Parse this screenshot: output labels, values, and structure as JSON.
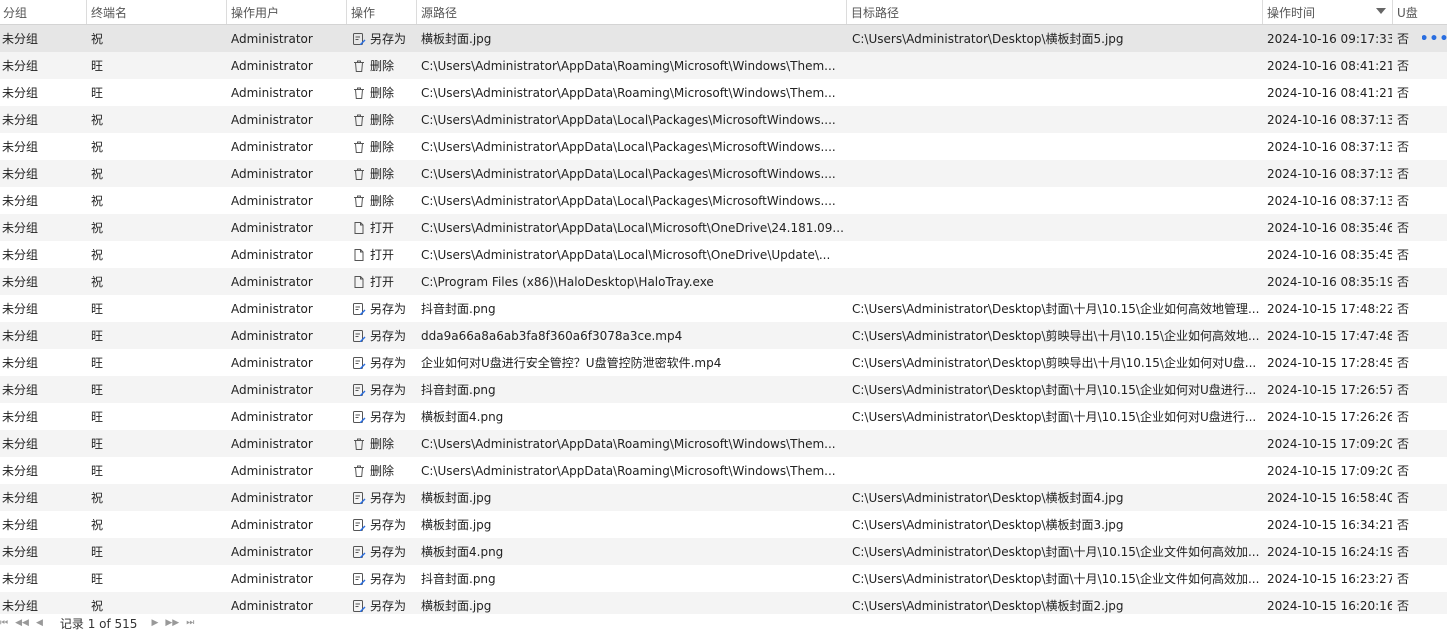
{
  "columns": {
    "group": "分组",
    "terminal": "终端名",
    "user": "操作用户",
    "operation": "操作",
    "source": "源路径",
    "target": "目标路径",
    "time": "操作时间",
    "usb": "U盘"
  },
  "rows": [
    {
      "group": "未分组",
      "terminal": "祝",
      "user": "Administrator",
      "op": "另存为",
      "op_icon": "save-as-icon",
      "source": "横板封面.jpg",
      "target": "C:\\Users\\Administrator\\Desktop\\横板封面5.jpg",
      "time": "2024-10-16 09:17:33",
      "usb": "否"
    },
    {
      "group": "未分组",
      "terminal": "旺",
      "user": "Administrator",
      "op": "删除",
      "op_icon": "trash-icon",
      "source": "C:\\Users\\Administrator\\AppData\\Roaming\\Microsoft\\Windows\\Them...",
      "target": "",
      "time": "2024-10-16 08:41:21",
      "usb": "否"
    },
    {
      "group": "未分组",
      "terminal": "旺",
      "user": "Administrator",
      "op": "删除",
      "op_icon": "trash-icon",
      "source": "C:\\Users\\Administrator\\AppData\\Roaming\\Microsoft\\Windows\\Them...",
      "target": "",
      "time": "2024-10-16 08:41:21",
      "usb": "否"
    },
    {
      "group": "未分组",
      "terminal": "祝",
      "user": "Administrator",
      "op": "删除",
      "op_icon": "trash-icon",
      "source": "C:\\Users\\Administrator\\AppData\\Local\\Packages\\MicrosoftWindows....",
      "target": "",
      "time": "2024-10-16 08:37:13",
      "usb": "否"
    },
    {
      "group": "未分组",
      "terminal": "祝",
      "user": "Administrator",
      "op": "删除",
      "op_icon": "trash-icon",
      "source": "C:\\Users\\Administrator\\AppData\\Local\\Packages\\MicrosoftWindows....",
      "target": "",
      "time": "2024-10-16 08:37:13",
      "usb": "否"
    },
    {
      "group": "未分组",
      "terminal": "祝",
      "user": "Administrator",
      "op": "删除",
      "op_icon": "trash-icon",
      "source": "C:\\Users\\Administrator\\AppData\\Local\\Packages\\MicrosoftWindows....",
      "target": "",
      "time": "2024-10-16 08:37:13",
      "usb": "否"
    },
    {
      "group": "未分组",
      "terminal": "祝",
      "user": "Administrator",
      "op": "删除",
      "op_icon": "trash-icon",
      "source": "C:\\Users\\Administrator\\AppData\\Local\\Packages\\MicrosoftWindows....",
      "target": "",
      "time": "2024-10-16 08:37:13",
      "usb": "否"
    },
    {
      "group": "未分组",
      "terminal": "祝",
      "user": "Administrator",
      "op": "打开",
      "op_icon": "file-icon",
      "source": "C:\\Users\\Administrator\\AppData\\Local\\Microsoft\\OneDrive\\24.181.09...",
      "target": "",
      "time": "2024-10-16 08:35:46",
      "usb": "否"
    },
    {
      "group": "未分组",
      "terminal": "祝",
      "user": "Administrator",
      "op": "打开",
      "op_icon": "file-icon",
      "source": "C:\\Users\\Administrator\\AppData\\Local\\Microsoft\\OneDrive\\Update\\...",
      "target": "",
      "time": "2024-10-16 08:35:45",
      "usb": "否"
    },
    {
      "group": "未分组",
      "terminal": "祝",
      "user": "Administrator",
      "op": "打开",
      "op_icon": "file-icon",
      "source": "C:\\Program Files (x86)\\HaloDesktop\\HaloTray.exe",
      "target": "",
      "time": "2024-10-16 08:35:19",
      "usb": "否"
    },
    {
      "group": "未分组",
      "terminal": "旺",
      "user": "Administrator",
      "op": "另存为",
      "op_icon": "save-as-icon",
      "source": "抖音封面.png",
      "target": "C:\\Users\\Administrator\\Desktop\\封面\\十月\\10.15\\企业如何高效地管理...",
      "time": "2024-10-15 17:48:22",
      "usb": "否"
    },
    {
      "group": "未分组",
      "terminal": "旺",
      "user": "Administrator",
      "op": "另存为",
      "op_icon": "save-as-icon",
      "source": "dda9a66a8a6ab3fa8f360a6f3078a3ce.mp4",
      "target": "C:\\Users\\Administrator\\Desktop\\剪映导出\\十月\\10.15\\企业如何高效地...",
      "time": "2024-10-15 17:47:48",
      "usb": "否"
    },
    {
      "group": "未分组",
      "terminal": "旺",
      "user": "Administrator",
      "op": "另存为",
      "op_icon": "save-as-icon",
      "source": "企业如何对U盘进行安全管控？U盘管控防泄密软件.mp4",
      "target": "C:\\Users\\Administrator\\Desktop\\剪映导出\\十月\\10.15\\企业如何对U盘...",
      "time": "2024-10-15 17:28:45",
      "usb": "否"
    },
    {
      "group": "未分组",
      "terminal": "旺",
      "user": "Administrator",
      "op": "另存为",
      "op_icon": "save-as-icon",
      "source": "抖音封面.png",
      "target": "C:\\Users\\Administrator\\Desktop\\封面\\十月\\10.15\\企业如何对U盘进行...",
      "time": "2024-10-15 17:26:57",
      "usb": "否"
    },
    {
      "group": "未分组",
      "terminal": "旺",
      "user": "Administrator",
      "op": "另存为",
      "op_icon": "save-as-icon",
      "source": "横板封面4.png",
      "target": "C:\\Users\\Administrator\\Desktop\\封面\\十月\\10.15\\企业如何对U盘进行...",
      "time": "2024-10-15 17:26:26",
      "usb": "否"
    },
    {
      "group": "未分组",
      "terminal": "旺",
      "user": "Administrator",
      "op": "删除",
      "op_icon": "trash-icon",
      "source": "C:\\Users\\Administrator\\AppData\\Roaming\\Microsoft\\Windows\\Them...",
      "target": "",
      "time": "2024-10-15 17:09:20",
      "usb": "否"
    },
    {
      "group": "未分组",
      "terminal": "旺",
      "user": "Administrator",
      "op": "删除",
      "op_icon": "trash-icon",
      "source": "C:\\Users\\Administrator\\AppData\\Roaming\\Microsoft\\Windows\\Them...",
      "target": "",
      "time": "2024-10-15 17:09:20",
      "usb": "否"
    },
    {
      "group": "未分组",
      "terminal": "祝",
      "user": "Administrator",
      "op": "另存为",
      "op_icon": "save-as-icon",
      "source": "横板封面.jpg",
      "target": "C:\\Users\\Administrator\\Desktop\\横板封面4.jpg",
      "time": "2024-10-15 16:58:40",
      "usb": "否"
    },
    {
      "group": "未分组",
      "terminal": "祝",
      "user": "Administrator",
      "op": "另存为",
      "op_icon": "save-as-icon",
      "source": "横板封面.jpg",
      "target": "C:\\Users\\Administrator\\Desktop\\横板封面3.jpg",
      "time": "2024-10-15 16:34:21",
      "usb": "否"
    },
    {
      "group": "未分组",
      "terminal": "旺",
      "user": "Administrator",
      "op": "另存为",
      "op_icon": "save-as-icon",
      "source": "横板封面4.png",
      "target": "C:\\Users\\Administrator\\Desktop\\封面\\十月\\10.15\\企业文件如何高效加...",
      "time": "2024-10-15 16:24:19",
      "usb": "否"
    },
    {
      "group": "未分组",
      "terminal": "旺",
      "user": "Administrator",
      "op": "另存为",
      "op_icon": "save-as-icon",
      "source": "抖音封面.png",
      "target": "C:\\Users\\Administrator\\Desktop\\封面\\十月\\10.15\\企业文件如何高效加...",
      "time": "2024-10-15 16:23:27",
      "usb": "否"
    },
    {
      "group": "未分组",
      "terminal": "祝",
      "user": "Administrator",
      "op": "另存为",
      "op_icon": "save-as-icon",
      "source": "横板封面.jpg",
      "target": "C:\\Users\\Administrator\\Desktop\\横板封面2.jpg",
      "time": "2024-10-15 16:20:16",
      "usb": "否"
    }
  ],
  "more_icon": "more-dots-icon",
  "footer": {
    "record_label": "记录 1 of 515",
    "first_icon": "first-page-icon",
    "prev_page_icon": "prev-page-icon",
    "prev_icon": "prev-record-icon",
    "next_icon": "next-record-icon",
    "next_page_icon": "next-page-icon",
    "last_icon": "last-page-icon"
  },
  "colors": {
    "accent": "#2a6ee0",
    "selected_row": "#e6e6e6",
    "alt_row": "#f4f4f4"
  }
}
